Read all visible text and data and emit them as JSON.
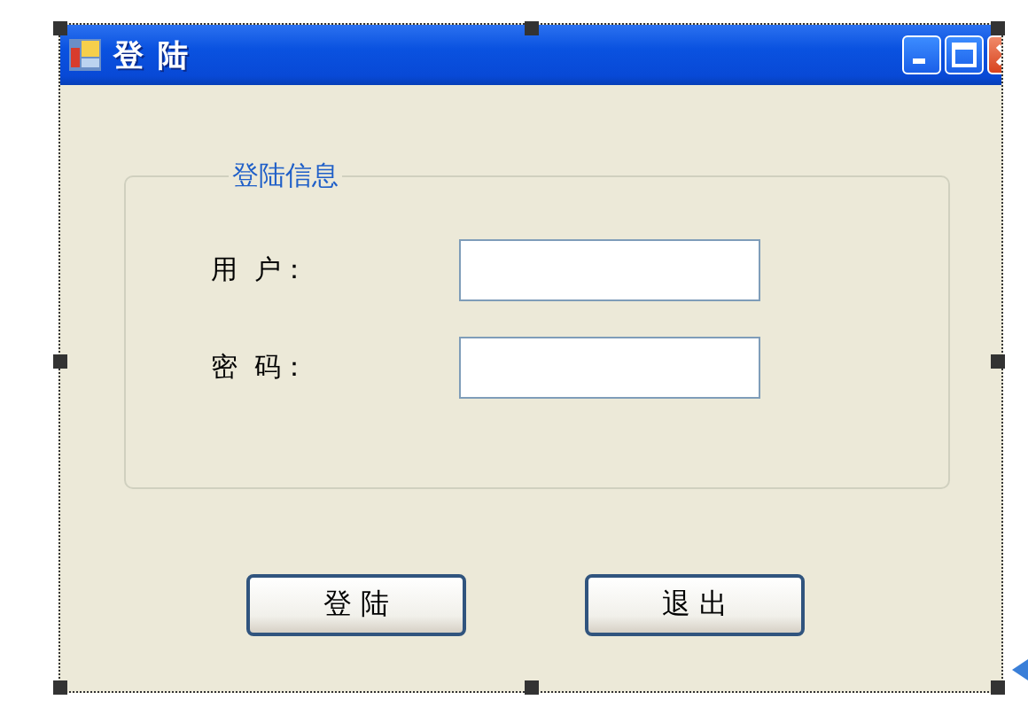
{
  "window": {
    "title": "登 陆"
  },
  "group": {
    "title": "登陆信息",
    "fields": [
      {
        "label": "用  户："
      },
      {
        "label": "密  码："
      }
    ]
  },
  "buttons": [
    "登 陆",
    "退 出"
  ]
}
